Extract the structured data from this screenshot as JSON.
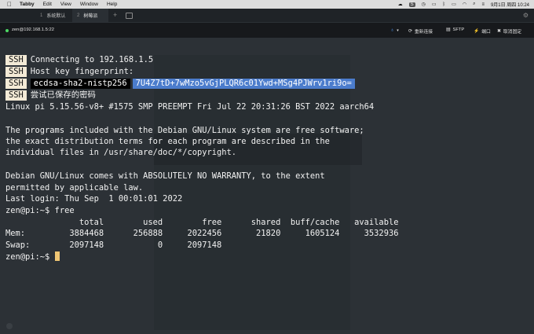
{
  "menubar": {
    "app": "Tabby",
    "menus": [
      "Edit",
      "View",
      "Window",
      "Help"
    ],
    "datetime": "9月1日 周四  10:24"
  },
  "tabs": [
    {
      "num": "1",
      "label": "系统默认"
    },
    {
      "num": "2",
      "label": "树莓派"
    }
  ],
  "toolbar": {
    "host": "zen@192.168.1.5:22",
    "reconnect": "重新连接",
    "sftp": "SFTP",
    "ports": "端口",
    "unpin": "取消固定"
  },
  "terminal": {
    "badge": "SSH",
    "ssh_lines": [
      "Connecting to 192.168.1.5",
      "Host key fingerprint:",
      "",
      "尝试已保存的密码"
    ],
    "fingerprint_type": "ecdsa-sha2-nistp256",
    "fingerprint_value": "7U4Z7tD+7wMzo5vGjPLQR6c01Ywd+MSg4PJWrv1ri9o=",
    "lines": [
      "Linux pi 5.15.56-v8+ #1575 SMP PREEMPT Fri Jul 22 20:31:26 BST 2022 aarch64",
      "",
      "The programs included with the Debian GNU/Linux system are free software;",
      "the exact distribution terms for each program are described in the",
      "individual files in /usr/share/doc/*/copyright.",
      "",
      "Debian GNU/Linux comes with ABSOLUTELY NO WARRANTY, to the extent",
      "permitted by applicable law.",
      "Last login: Thu Sep  1 00:01:01 2022",
      "zen@pi:~$ free",
      "               total        used        free      shared  buff/cache   available",
      "Mem:         3884468      256888     2022456       21820     1605124     3532936",
      "Swap:        2097148           0     2097148"
    ],
    "prompt": "zen@pi:~$ "
  }
}
